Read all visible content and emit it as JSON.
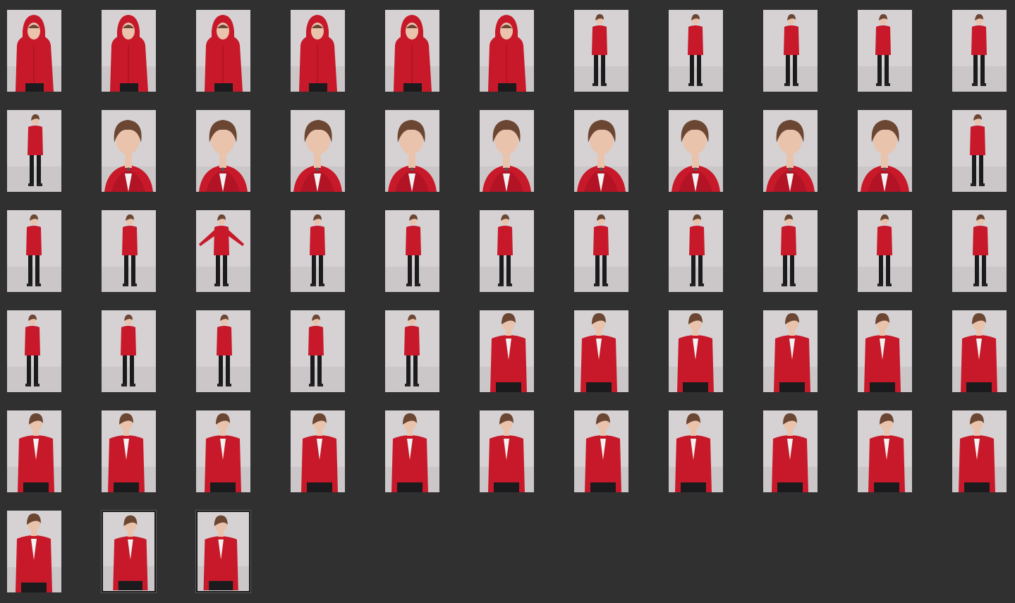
{
  "colors": {
    "background": "#303030",
    "backdrop": "#d6d2d4",
    "hoodie": "#c8192a",
    "hoodie_dark": "#9c1020",
    "hair": "#6b4632",
    "skin": "#e9c3ac",
    "pants": "#1b1b1e",
    "shirt": "#f2f2f2"
  },
  "thumbnails": [
    {
      "shot": "hood-up",
      "selected": false
    },
    {
      "shot": "hood-up",
      "selected": false
    },
    {
      "shot": "hood-up",
      "selected": false
    },
    {
      "shot": "hood-up",
      "selected": false
    },
    {
      "shot": "hood-up",
      "selected": false
    },
    {
      "shot": "hood-up",
      "selected": false
    },
    {
      "shot": "full-profile",
      "selected": false
    },
    {
      "shot": "full-profile",
      "selected": false
    },
    {
      "shot": "full-profile",
      "selected": false
    },
    {
      "shot": "full-profile",
      "selected": false
    },
    {
      "shot": "full-profile",
      "selected": false
    },
    {
      "shot": "full-profile",
      "selected": false
    },
    {
      "shot": "close",
      "selected": false
    },
    {
      "shot": "close",
      "selected": false
    },
    {
      "shot": "close",
      "selected": false
    },
    {
      "shot": "close",
      "selected": false
    },
    {
      "shot": "close",
      "selected": false
    },
    {
      "shot": "close",
      "selected": false
    },
    {
      "shot": "close",
      "selected": false
    },
    {
      "shot": "close",
      "selected": false
    },
    {
      "shot": "close",
      "selected": false
    },
    {
      "shot": "full",
      "selected": false
    },
    {
      "shot": "full",
      "selected": false
    },
    {
      "shot": "full",
      "selected": false
    },
    {
      "shot": "full-arms",
      "selected": false
    },
    {
      "shot": "full",
      "selected": false
    },
    {
      "shot": "full",
      "selected": false
    },
    {
      "shot": "full",
      "selected": false
    },
    {
      "shot": "full",
      "selected": false
    },
    {
      "shot": "full",
      "selected": false
    },
    {
      "shot": "full",
      "selected": false
    },
    {
      "shot": "full",
      "selected": false
    },
    {
      "shot": "full",
      "selected": false
    },
    {
      "shot": "full",
      "selected": false
    },
    {
      "shot": "full",
      "selected": false
    },
    {
      "shot": "full",
      "selected": false
    },
    {
      "shot": "full",
      "selected": false
    },
    {
      "shot": "full",
      "selected": false
    },
    {
      "shot": "medium-profile",
      "selected": false
    },
    {
      "shot": "medium-profile",
      "selected": false
    },
    {
      "shot": "medium-profile",
      "selected": false
    },
    {
      "shot": "medium-profile",
      "selected": false
    },
    {
      "shot": "medium-profile",
      "selected": false
    },
    {
      "shot": "medium-profile",
      "selected": false
    },
    {
      "shot": "medium",
      "selected": false
    },
    {
      "shot": "medium",
      "selected": false
    },
    {
      "shot": "medium",
      "selected": false
    },
    {
      "shot": "medium-profile",
      "selected": false
    },
    {
      "shot": "medium-profile",
      "selected": false
    },
    {
      "shot": "medium",
      "selected": false
    },
    {
      "shot": "medium",
      "selected": false
    },
    {
      "shot": "medium",
      "selected": false
    },
    {
      "shot": "medium",
      "selected": false
    },
    {
      "shot": "medium",
      "selected": false
    },
    {
      "shot": "medium",
      "selected": false
    },
    {
      "shot": "medium",
      "selected": false
    },
    {
      "shot": "medium",
      "selected": true
    },
    {
      "shot": "medium",
      "selected": true
    }
  ]
}
